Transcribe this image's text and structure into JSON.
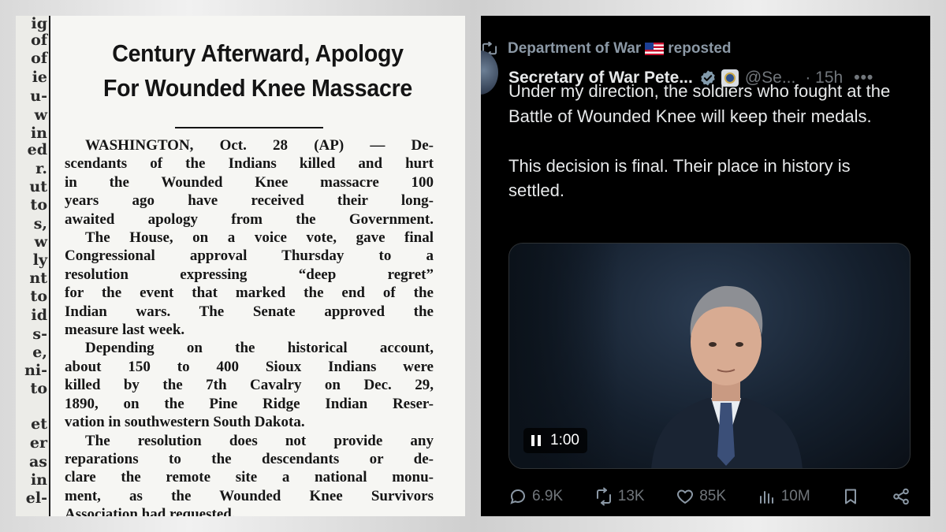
{
  "article": {
    "headline_line1": "Century Afterward, Apology",
    "headline_line2": "For Wounded Knee Massacre",
    "margin_fragments": [
      "ig",
      "of",
      "of",
      "ie",
      "u-",
      "w",
      "in",
      "ed",
      "r.",
      "ut",
      "to",
      "s,",
      "w",
      "ly",
      "nt",
      "to",
      "id",
      "s-",
      "e,",
      "ni-",
      "to",
      "",
      "et",
      "er",
      "as",
      "in",
      "el-"
    ],
    "body_lines": [
      "WASHINGTON, Oct. 28 (AP) — De-",
      "scendants of the Indians killed and hurt",
      "in the Wounded Knee massacre 100",
      "years ago have received their long-",
      "awaited apology from the Government.",
      "The House, on a voice vote, gave final",
      "Congressional approval Thursday to a",
      "resolution expressing “deep regret”",
      "for the event that marked the end of the",
      "Indian wars. The Senate approved the",
      "measure last week.",
      "Depending on the historical account,",
      "about 150 to 400 Sioux Indians were",
      "killed by the 7th Cavalry on Dec. 29,",
      "1890, on the Pine Ridge Indian Reser-",
      "vation in southwestern South Dakota.",
      "The resolution does not provide any",
      "reparations to the descendants or de-",
      "clare the remote site a national monu-",
      "ment, as the Wounded Knee Survivors",
      "Association had requested."
    ]
  },
  "tweet": {
    "repost_account": "Department of War",
    "repost_suffix": "reposted",
    "author_name": "Secretary of War Pete...",
    "handle": "@Se...",
    "time": "· 15h",
    "more": "•••",
    "paragraph1": "Under my direction, the soldiers who fought at the Battle of Wounded Knee will keep their medals.",
    "paragraph2": "This decision is final. Their place in history is settled.",
    "video_time": "1:00",
    "replies": "6.9K",
    "reposts": "13K",
    "likes": "85K",
    "views": "10M",
    "colors": {
      "background": "#000000",
      "text": "#e7e9ea",
      "muted": "#71767b",
      "verified": "#1d9bf0"
    }
  }
}
